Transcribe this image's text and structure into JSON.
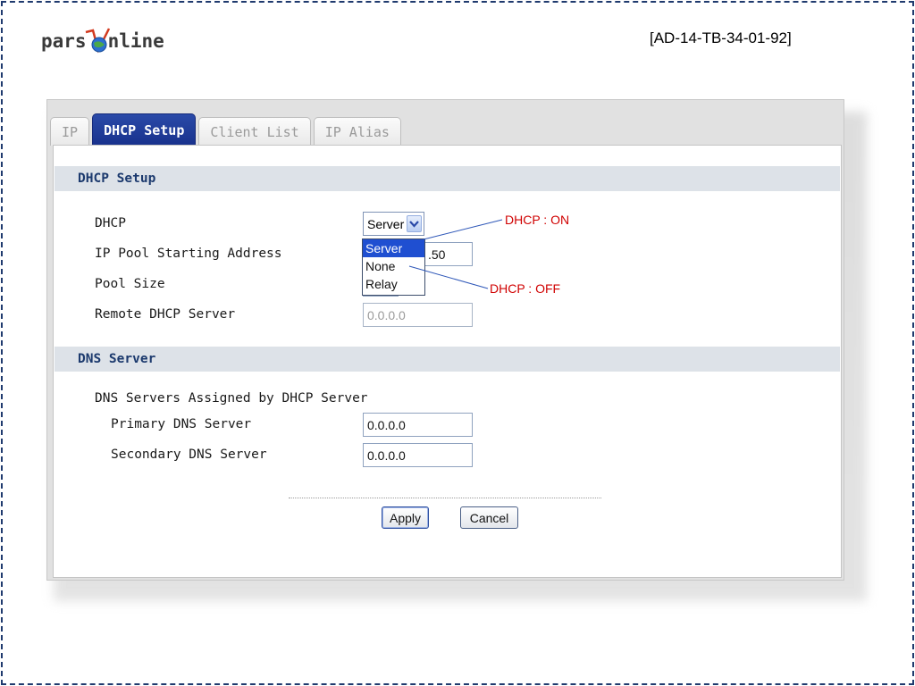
{
  "logo": {
    "left_text": "pars",
    "right_text": "nline"
  },
  "doc_id": "[AD-14-TB-34-01-92]",
  "tabs": [
    {
      "label": "IP",
      "active": false
    },
    {
      "label": "DHCP Setup",
      "active": true
    },
    {
      "label": "Client List",
      "active": false
    },
    {
      "label": "IP Alias",
      "active": false
    }
  ],
  "dhcp_section": {
    "header": "DHCP Setup",
    "dhcp_label": "DHCP",
    "dhcp_value": "Server",
    "dhcp_options": [
      "Server",
      "None",
      "Relay"
    ],
    "pool_start_label": "IP Pool Starting Address",
    "pool_start_value_visible": ".50",
    "pool_size_label": "Pool Size",
    "remote_dhcp_label": "Remote DHCP Server",
    "remote_dhcp_value": "0.0.0.0"
  },
  "dns_section": {
    "header": "DNS Server",
    "assigned_label": "DNS Servers Assigned by DHCP Server",
    "primary_label": "Primary DNS Server",
    "primary_value": "0.0.0.0",
    "secondary_label": "Secondary DNS Server",
    "secondary_value": "0.0.0.0"
  },
  "annotations": {
    "on": "DHCP : ON",
    "off": "DHCP : OFF"
  },
  "buttons": {
    "apply": "Apply",
    "cancel": "Cancel"
  },
  "colors": {
    "active_tab": "#1f3a9a",
    "annotation": "#d00000",
    "section_header_bg": "#dde2e8"
  },
  "icons": {
    "logo_globe": "globe-icon",
    "dropdown_arrow": "chevron-down-icon"
  }
}
